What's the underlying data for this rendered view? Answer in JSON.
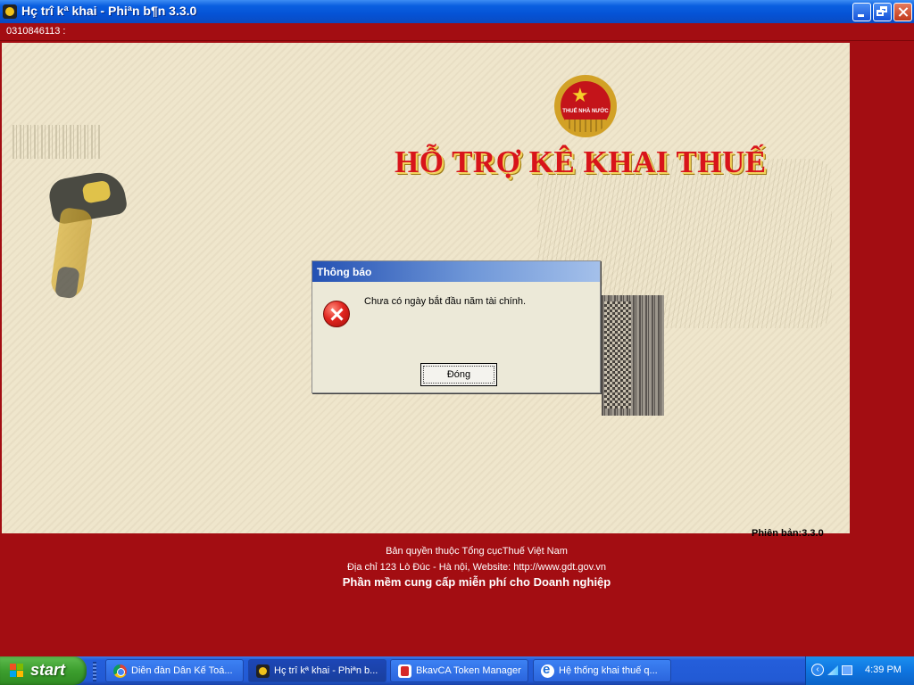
{
  "window": {
    "title": "Hç trî kª khai - Phiªn b¶n 3.3.0"
  },
  "app": {
    "tin": "0310846113 :",
    "emblem_text": "THUẾ NHÀ NƯỚC",
    "heading": "HỖ TRỢ KÊ KHAI THUẾ",
    "version": "Phiên bản:3.3.0",
    "footer": {
      "copyright": "Bản quyền thuộc Tổng cụcThuế Việt Nam",
      "address": "Địa chỉ 123 Lò Đúc - Hà nội,  Website: http://www.gdt.gov.vn",
      "tagline": "Phần mềm cung cấp miễn phí cho Doanh nghiệp"
    }
  },
  "dialog": {
    "title": "Thông báo",
    "message": "Chưa có ngày bắt đầu năm tài chính.",
    "ok_label": "Đóng",
    "icon": "error-icon"
  },
  "taskbar": {
    "start_label": "start",
    "tasks": [
      {
        "label": "Diễn đàn Dân Kế Toá...",
        "icon": "chrome-icon"
      },
      {
        "label": "Hç trî kª khai - Phiªn b...",
        "icon": "app-icon"
      },
      {
        "label": "BkavCA Token Manager",
        "icon": "bkav-icon"
      },
      {
        "label": "Hệ thống khai thuế q...",
        "icon": "ie-icon"
      }
    ],
    "clock": "4:39 PM"
  },
  "colors": {
    "brand_red": "#a30d12",
    "canvas": "#efe6cc",
    "heading_red": "#d8141b"
  }
}
